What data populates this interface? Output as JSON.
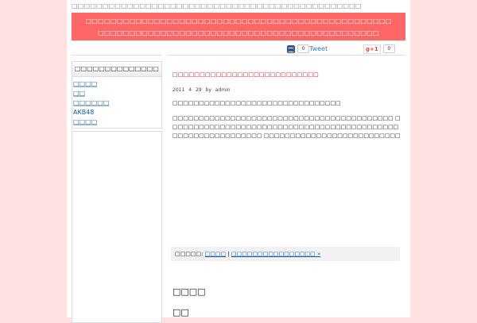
{
  "site": {
    "tagline": "□□□□□□□□□□□□□□□□□□□□□□□□□□□□□□□□□□□□□□□□□□□□□□□"
  },
  "banner": {
    "line1": "□□□□□□□□□□□□□□□□□□□□□□□□□□□□□□□□□□□□□□□□□□□□□□□□□",
    "line2": "□□□□□□□□□□□□□□□□□□□□□□□□□□□□□□□□□□□□□□□□□□□□□"
  },
  "social": {
    "like_count": "0",
    "tweet_label": "Tweet",
    "gplus_label": "g+1",
    "gplus_count": "0"
  },
  "sidebar": {
    "widget_title": "□□□□□□□□□□□□□□",
    "items": [
      {
        "label": "□□□□"
      },
      {
        "label": "□□"
      },
      {
        "label": "□□□□□□"
      },
      {
        "label": "AKB48"
      },
      {
        "label": "□□□□"
      }
    ]
  },
  "post": {
    "title": "□□□□□□□□□□□□□□□□□□□□□□□□□□□",
    "meta": {
      "year": "2011",
      "month": "4",
      "day": "29",
      "by": "by admin"
    },
    "paragraph1": "□□□□□□□□□□□□□□□□□□□□□□□□□□□□□□□□",
    "paragraph2": "□□□□□□□□□□□□□□□□□□□□□□□□□□□□□□□□□□□□□□□□□□ □□□□□□□□□□□□□□□□□□□□□□□□□□□□□□□□□□□□□□□□□□□□□□□□□□□□□□□□□□□□□ □□□□□□□□□□□□□□□□□□□□□□□□□□",
    "footer": {
      "label": "□□□□□:",
      "category": "□□□□",
      "separator": "|",
      "next": "□□□□□□□□□□□□□□□□ »"
    }
  },
  "sections": {
    "heading1": "□□□□",
    "heading2": "□□"
  }
}
